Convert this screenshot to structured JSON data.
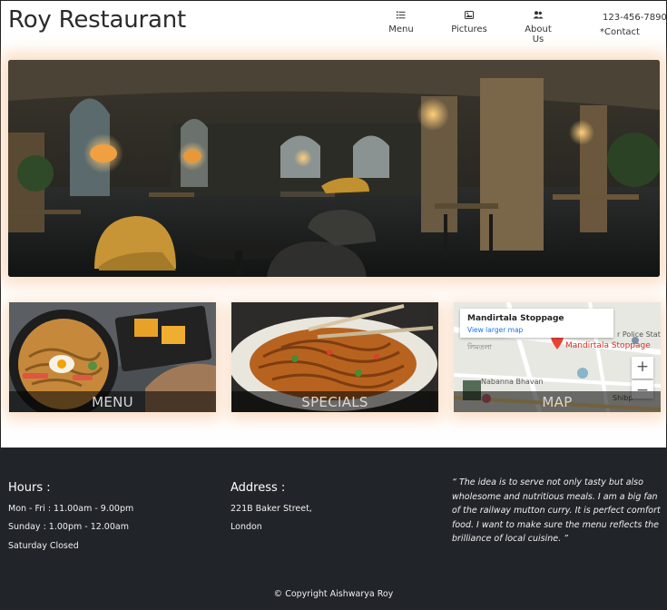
{
  "brand": {
    "name": "Roy Restaurant"
  },
  "nav": {
    "items": [
      {
        "label": "Menu",
        "icon": "list-icon"
      },
      {
        "label": "Pictures",
        "icon": "image-icon"
      },
      {
        "label": "About Us",
        "icon": "users-icon"
      }
    ],
    "phone": "123-456-7890",
    "contact": "*Contact"
  },
  "hero": {
    "description": "restaurant interior photo"
  },
  "cards": [
    {
      "label": "MENU"
    },
    {
      "label": "SPECIALS"
    },
    {
      "label": "MAP",
      "map": {
        "place_title": "Mandirtala Stoppage",
        "link": "View larger map",
        "pin_label": "Mandirtala Stoppage",
        "zoom_in": "+",
        "zoom_out": "−"
      }
    }
  ],
  "footer": {
    "hours": {
      "title": "Hours :",
      "lines": [
        "Mon - Fri : 11.00am - 9.00pm",
        "Sunday : 1.00pm - 12.00am",
        "Saturday Closed"
      ]
    },
    "address": {
      "title": "Address :",
      "lines": [
        "221B Baker Street,",
        "London"
      ]
    },
    "quote": "“ The idea is to serve not only tasty but also wholesome and nutritious meals. I am a big fan of the railway mutton curry. It is perfect comfort food. I want to make sure the menu reflects the brilliance of local cuisine. ”",
    "copyright": "© Copyright Aishwarya Roy"
  },
  "colors": {
    "footer_bg": "#212429",
    "accent_glow": "#f5c396",
    "map_pin": "#d93025",
    "map_link": "#1a73e8"
  }
}
